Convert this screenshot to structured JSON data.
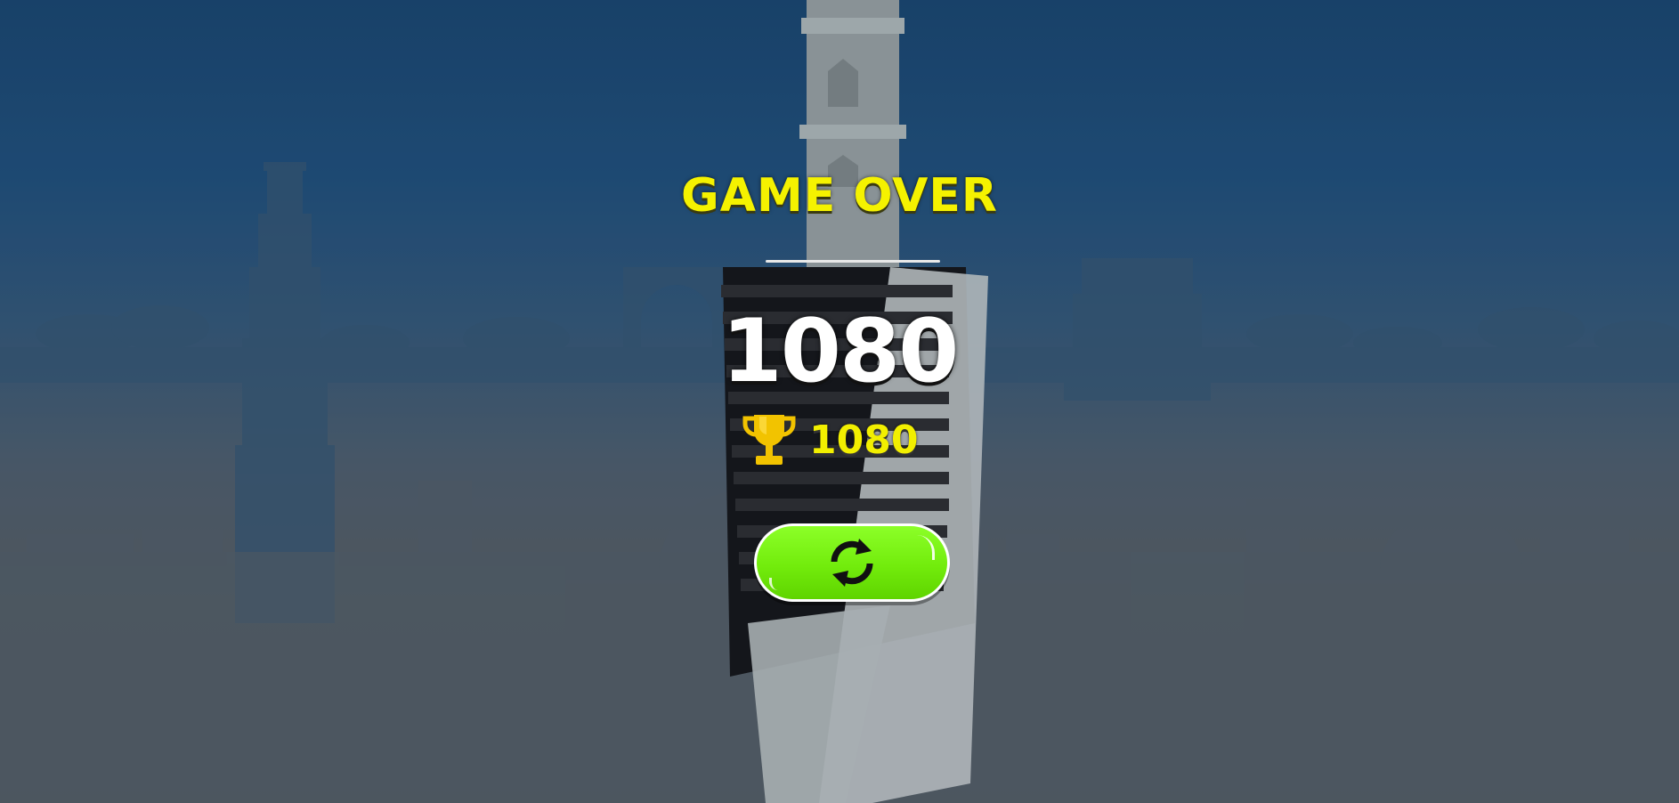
{
  "game": {
    "title": "GAME OVER",
    "score": "1080",
    "best_score": "1080"
  },
  "icons": {
    "trophy": "trophy-icon",
    "replay": "refresh-icon"
  },
  "colors": {
    "title": "#f5f200",
    "score": "#ffffff",
    "best_score": "#f2ef00",
    "replay_button": "#72ec0c",
    "sky_top": "#11406f",
    "ground": "#555759"
  }
}
